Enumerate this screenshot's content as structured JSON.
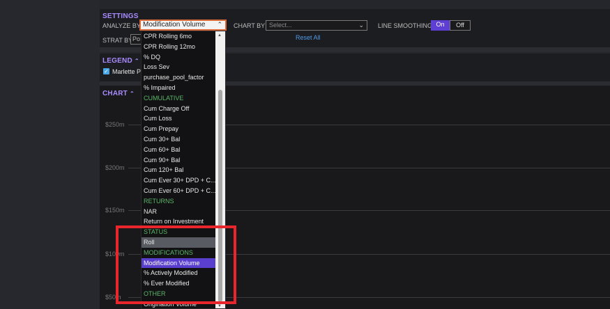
{
  "settings": {
    "title": "SETTINGS",
    "analyze_by_label": "ANALYZE BY",
    "analyze_by_value": "Modification Volume",
    "chart_by_label": "CHART BY",
    "chart_by_placeholder": "Select...",
    "line_smoothing_label": "LINE SMOOTHING",
    "on_label": "On",
    "off_label": "Off",
    "strat_by_label": "STRAT BY",
    "strat_by_value": "Po",
    "reset_label": "Reset All"
  },
  "legend": {
    "title": "LEGEND",
    "item_label": "Marlette P"
  },
  "chart": {
    "title": "CHART"
  },
  "chart_data": {
    "type": "line",
    "title": "",
    "y_ticks": [
      "$250m",
      "$200m",
      "$150m",
      "$100m",
      "$50m"
    ],
    "series": [],
    "grid": true
  },
  "dropdown": {
    "items": [
      {
        "label": "CPR Rolling 6mo",
        "kind": "option"
      },
      {
        "label": "CPR Rolling 12mo",
        "kind": "option"
      },
      {
        "label": "% DQ",
        "kind": "option"
      },
      {
        "label": "Loss Sev",
        "kind": "option"
      },
      {
        "label": "purchase_pool_factor",
        "kind": "option"
      },
      {
        "label": "% Impaired",
        "kind": "option"
      },
      {
        "label": "CUMULATIVE",
        "kind": "group"
      },
      {
        "label": "Cum Charge Off",
        "kind": "option"
      },
      {
        "label": "Cum Loss",
        "kind": "option"
      },
      {
        "label": "Cum Prepay",
        "kind": "option"
      },
      {
        "label": "Cum 30+ Bal",
        "kind": "option"
      },
      {
        "label": "Cum 60+ Bal",
        "kind": "option"
      },
      {
        "label": "Cum 90+ Bal",
        "kind": "option"
      },
      {
        "label": "Cum 120+ Bal",
        "kind": "option"
      },
      {
        "label": "Cum Ever 30+ DPD + C...",
        "kind": "option"
      },
      {
        "label": "Cum Ever 60+ DPD + C...",
        "kind": "option"
      },
      {
        "label": "RETURNS",
        "kind": "group"
      },
      {
        "label": "NAR",
        "kind": "option"
      },
      {
        "label": "Return on Investment",
        "kind": "option"
      },
      {
        "label": "STATUS",
        "kind": "group"
      },
      {
        "label": "Roll",
        "kind": "hover"
      },
      {
        "label": "MODIFICATIONS",
        "kind": "group"
      },
      {
        "label": "Modification Volume",
        "kind": "selected"
      },
      {
        "label": "% Actively Modified",
        "kind": "option"
      },
      {
        "label": "% Ever Modified",
        "kind": "option"
      },
      {
        "label": "OTHER",
        "kind": "group"
      },
      {
        "label": "Origination Volume",
        "kind": "option"
      }
    ]
  },
  "colors": {
    "accent": "#5a3fcf",
    "section_title": "#a98bff",
    "group_label": "#5cb86a",
    "highlight": "#e8262b",
    "link": "#4f9ae6"
  }
}
